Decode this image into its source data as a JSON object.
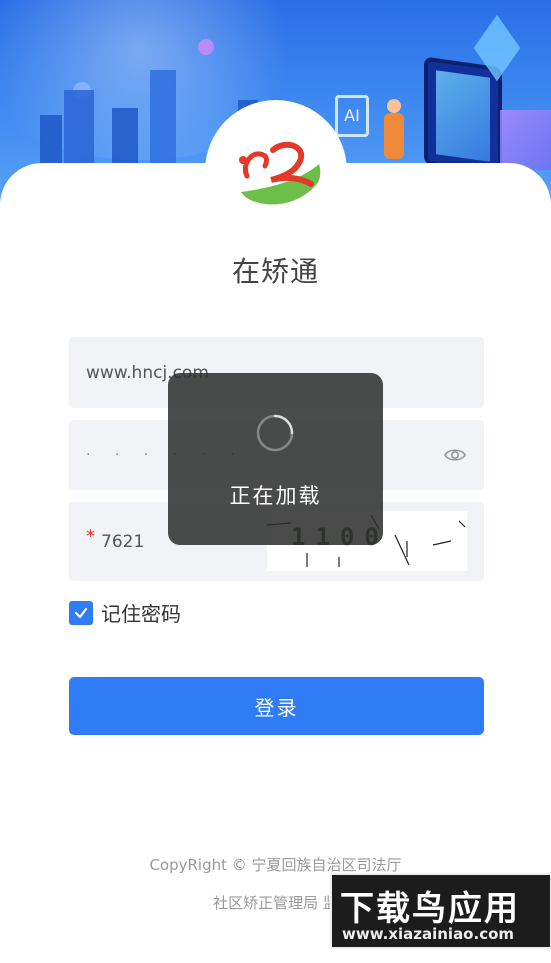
{
  "app": {
    "title": "在矫通"
  },
  "form": {
    "username_value": "www.hncj.com",
    "password_value": "· · · · · ·",
    "code_required_mark": "*",
    "code_value": "7621",
    "captcha_text": "1100",
    "remember_label": "记住密码",
    "remember_checked": true
  },
  "buttons": {
    "login_label": "登录"
  },
  "footer": {
    "copyright": "CopyRight © 宁夏回族自治区司法厅",
    "department": "社区矫正管理局 监"
  },
  "toast": {
    "message": "正在加载"
  },
  "watermark": {
    "big": "下载鸟应用",
    "small": "www.xiazainiao.com"
  },
  "colors": {
    "primary": "#2f7cf6",
    "field_bg": "#f2f3f7",
    "required": "#e0312b"
  }
}
